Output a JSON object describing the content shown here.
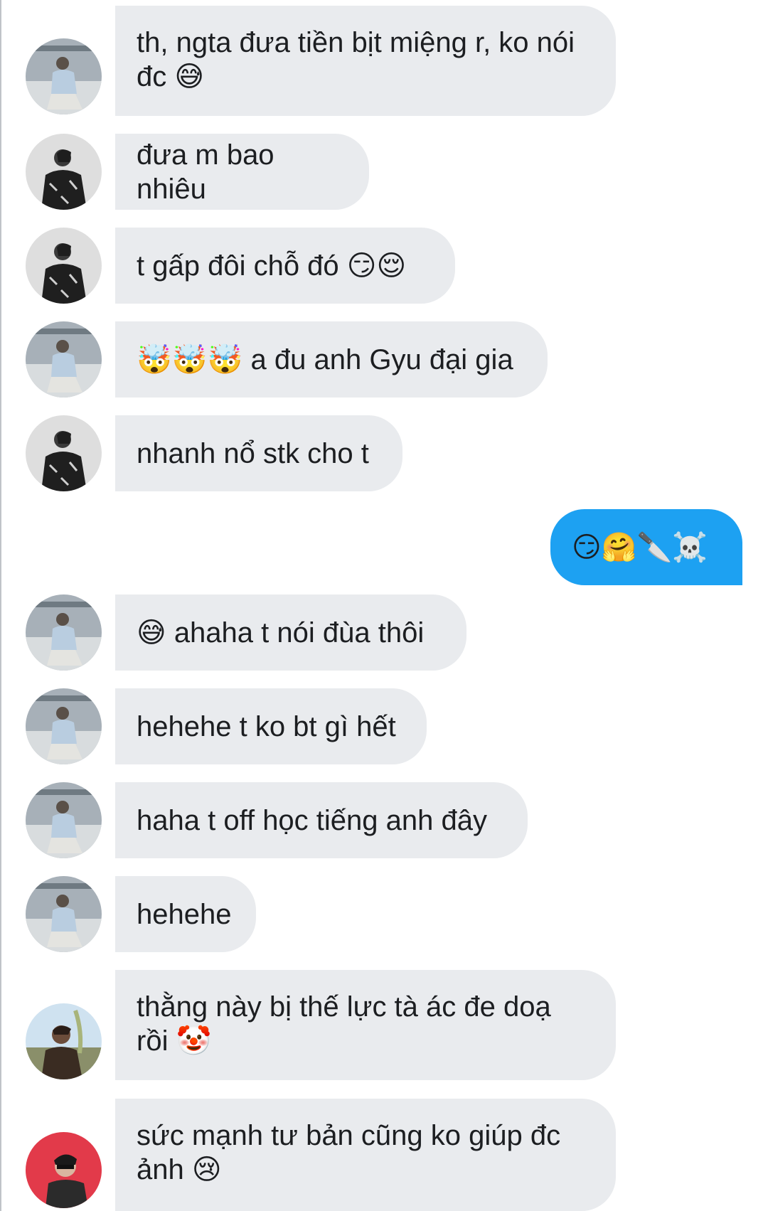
{
  "thread": {
    "messages": [
      {
        "sender": "friend-gray",
        "text": "th, ngta đưa tiền bịt miệng r, ko nói\nđc 😅"
      },
      {
        "sender": "friend-black",
        "text": "đưa m bao nhiêu"
      },
      {
        "sender": "friend-black",
        "text": "t gấp đôi chỗ đó 😏😌"
      },
      {
        "sender": "friend-gray",
        "text": "🤯🤯🤯 a đu anh Gyu đại gia"
      },
      {
        "sender": "friend-black",
        "text": "nhanh nổ stk cho t"
      },
      {
        "sender": "me",
        "text": "😏🤗🔪☠️"
      },
      {
        "sender": "friend-gray",
        "text": "😅 ahaha t nói đùa thôi"
      },
      {
        "sender": "friend-gray",
        "text": "hehehe t ko bt gì hết"
      },
      {
        "sender": "friend-gray",
        "text": "haha t off học tiếng anh đây"
      },
      {
        "sender": "friend-gray",
        "text": "hehehe"
      },
      {
        "sender": "friend-brown",
        "text": "thằng này bị thế lực tà ác đe doạ\nrồi 🤡"
      },
      {
        "sender": "friend-red",
        "text": "sức mạnh tư bản cũng ko giúp đc\nảnh 😢"
      }
    ]
  },
  "colors": {
    "incoming_bubble": "#e9ebee",
    "outgoing_bubble": "#1da1f2",
    "text": "#1c1e21"
  }
}
